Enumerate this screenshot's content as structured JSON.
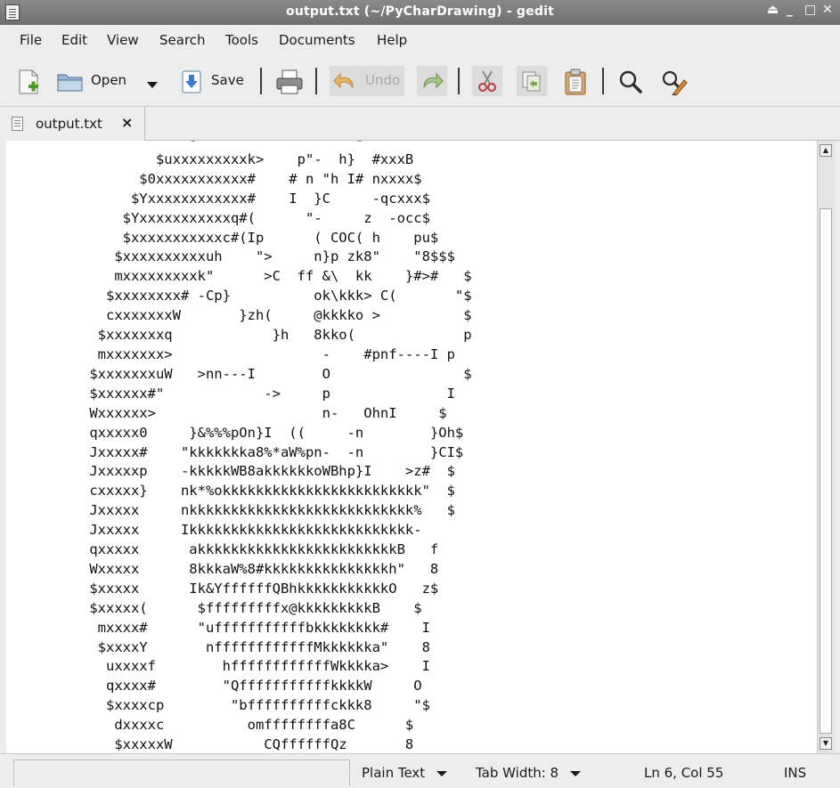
{
  "window": {
    "title": "output.txt (~/PyCharDrawing) - gedit",
    "controls": [
      "⏏",
      "_",
      "□",
      "✕"
    ]
  },
  "menubar": {
    "items": [
      "File",
      "Edit",
      "View",
      "Search",
      "Tools",
      "Documents",
      "Help"
    ]
  },
  "toolbar": {
    "open_label": "Open",
    "save_label": "Save",
    "undo_label": "Undo",
    "icons": {
      "new": "new-document-icon",
      "open": "folder-open-icon",
      "open_menu": "chevron-down-icon",
      "save": "save-arrow-icon",
      "print": "printer-icon",
      "undo": "undo-arrow-icon",
      "redo": "redo-arrow-icon",
      "cut": "scissors-icon",
      "copy": "copy-icon",
      "paste": "clipboard-icon",
      "find": "magnifier-icon",
      "replace": "find-replace-icon"
    }
  },
  "tab": {
    "label": "output.txt",
    "close": "×"
  },
  "editor": {
    "text": "                      -          \"        - `\n                  $uxxxxxxxxxk>    p\"-  h}  #xxxB\n                $0xxxxxxxxxxx#    # n \"h I# nxxxx$\n               $Yxxxxxxxxxxxx#    I  }C     -qcxxx$\n              $Yxxxxxxxxxxxq#(      \"-     z  -occ$\n              $xxxxxxxxxxxc#(Ip      ( COC( h    pu$\n             $xxxxxxxxxxuh    \">     n}p zk8\"    \"8$$$\n             mxxxxxxxxxk\"      >C  ff &\\  kk    }#>#   $\n            $xxxxxxxx# -Cp}          ok\\kkk> C(       \"$\n            cxxxxxxxW       }zh(     @kkkko >          $\n           $xxxxxxxq            }h   8kko(             p\n           mxxxxxxx>                  -    #pnf----I p\n          $xxxxxxxuW   >nn---I        O                $\n          $xxxxxx#\"            ->     p              I\n          Wxxxxxx>                    n-   OhnI     $\n          qxxxxx0     }&%%%pOn}I  ((     -n        }Oh$\n          Jxxxxx#    \"kkkkkkka8%*aW%pn-  -n        }CI$\n          Jxxxxxp    -kkkkkWB8akkkkkkoWBhp}I    >z#  $\n          cxxxxx}    nk*%okkkkkkkkkkkkkkkkkkkkkkkk\"  $\n          Jxxxxx     nkkkkkkkkkkkkkkkkkkkkkkkkkkk%   $\n          Jxxxxx     Ikkkkkkkkkkkkkkkkkkkkkkkkkkk-\n          qxxxxx      akkkkkkkkkkkkkkkkkkkkkkkkB   f\n          Wxxxxx      8kkkaW%8#kkkkkkkkkkkkkkkh\"   8\n          $xxxxx      Ik&YffffffQBhkkkkkkkkkkkO   z$\n          $xxxxx(      $fffffffffx@kkkkkkkkkB    $\n           mxxxx#      \"ufffffffffffbkkkkkkkk#    I\n           $xxxxY       nffffffffffffMkkkkkka\"    8\n            uxxxxf        hffffffffffffWkkkka>    I\n            qxxxx#        \"QfffffffffffkkkkW     O\n            $xxxxcp        \"bffffffffffckkk8     \"$\n             dxxxxc          omffffffffa8C      $\n             $xxxxxW           CQffffffQz       8\n               -   --  .          _ kk--  ( --     o -"
  },
  "statusbar": {
    "language": "Plain Text",
    "tab_width": "Tab Width: 8",
    "position": "Ln 6, Col 55",
    "mode": "INS"
  }
}
